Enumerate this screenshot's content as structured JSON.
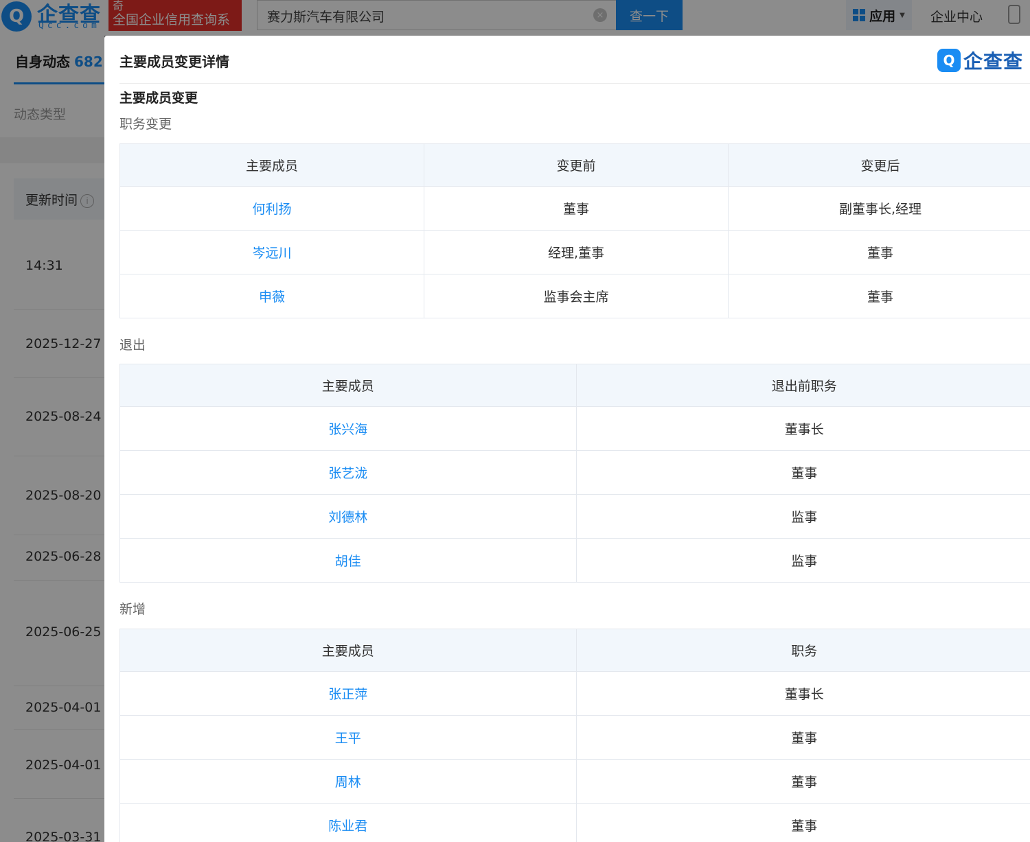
{
  "topbar": {
    "logo_mark": "Q",
    "logo_text": "企查查",
    "logo_sub": "Qcc.com",
    "slogan_line1": "奇",
    "slogan_line2": "全国企业信用查询系",
    "search_value": "赛力斯汽车有限公司",
    "search_button": "查一下",
    "app_menu": "应用",
    "enterprise_center": "企业中心"
  },
  "left_panel": {
    "tab_label": "自身动态",
    "tab_count": "682",
    "type_label": "动态类型",
    "header_label": "更新时间",
    "rows": [
      "14:31",
      "2025-12-27",
      "2025-08-24",
      "2025-08-20",
      "2025-06-28",
      "2025-06-25",
      "2025-04-01",
      "2025-04-01",
      "2025-03-31"
    ]
  },
  "modal": {
    "title": "主要成员变更详情",
    "logo_text": "企查查",
    "section_title": "主要成员变更",
    "position_change": {
      "label": "职务变更",
      "headers": [
        "主要成员",
        "变更前",
        "变更后"
      ],
      "rows": [
        {
          "member": "何利扬",
          "before": "董事",
          "after": "副董事长,经理"
        },
        {
          "member": "岑远川",
          "before": "经理,董事",
          "after": "董事"
        },
        {
          "member": "申薇",
          "before": "监事会主席",
          "after": "董事"
        }
      ]
    },
    "exit": {
      "label": "退出",
      "headers": [
        "主要成员",
        "退出前职务"
      ],
      "rows": [
        {
          "member": "张兴海",
          "role": "董事长"
        },
        {
          "member": "张艺泷",
          "role": "董事"
        },
        {
          "member": "刘德林",
          "role": "监事"
        },
        {
          "member": "胡佳",
          "role": "监事"
        }
      ]
    },
    "added": {
      "label": "新增",
      "headers": [
        "主要成员",
        "职务"
      ],
      "rows": [
        {
          "member": "张正萍",
          "role": "董事长"
        },
        {
          "member": "王平",
          "role": "董事"
        },
        {
          "member": "周林",
          "role": "董事"
        },
        {
          "member": "陈业君",
          "role": "董事"
        }
      ]
    }
  }
}
